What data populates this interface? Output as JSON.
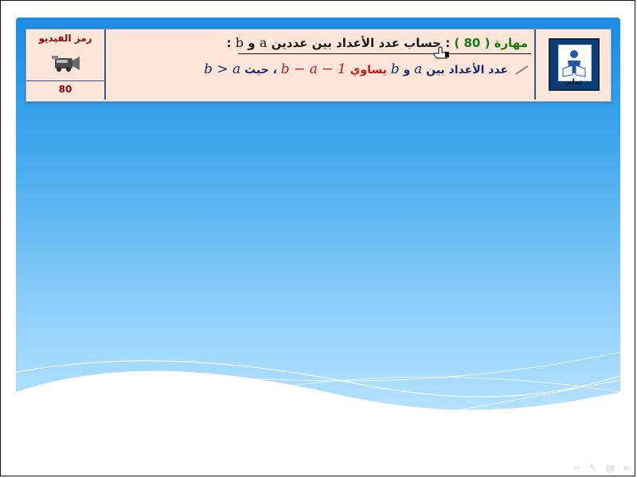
{
  "video_box": {
    "label": "رمز الفيديو",
    "number": "80",
    "icon": "video-camera-icon"
  },
  "skill": {
    "prefix": "مهارة ( 80 )",
    "colon": ":",
    "title": "حساب عدد الأعداد بين عددين",
    "var_a": "a",
    "and": "و",
    "var_b": "b",
    "end_colon": ":"
  },
  "rule": {
    "text1": "عدد الأعداد بين",
    "var_a": "a",
    "and": "و",
    "var_b": "b",
    "equals": "يساوي",
    "expr": "b − a − 1",
    "comma": "،",
    "where": "حيث",
    "cond": "b > a"
  },
  "logo": {
    "text": "تعلم",
    "icon": "learning-logo-icon"
  },
  "nav": {
    "prev": "⇦",
    "pen": "✎",
    "menu": "▤",
    "next": "⇨"
  },
  "colors": {
    "header_bg": "#fde5da",
    "skill_green": "#127a12",
    "rule_red": "#c41818",
    "rule_navy": "#1b2c66",
    "slide_blue": "#1c8de2"
  }
}
